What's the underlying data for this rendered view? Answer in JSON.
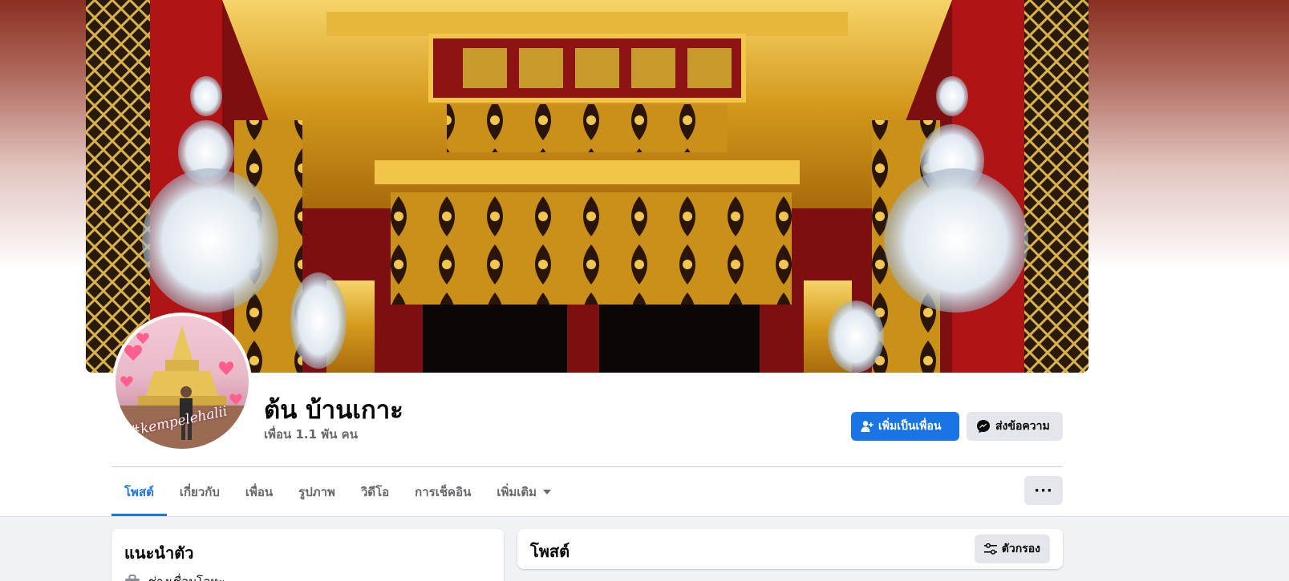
{
  "profile": {
    "name": "ต้น บ้านเกาะ",
    "friends": "เพื่อน 1.1 พัน คน",
    "avatar_tag": "#kempelehalii"
  },
  "actions": {
    "add_friend": "เพิ่มเป็นเพื่อน",
    "message": "ส่งข้อความ",
    "more": "···"
  },
  "tabs": [
    {
      "label": "โพสต์",
      "active": true
    },
    {
      "label": "เกี่ยวกับ"
    },
    {
      "label": "เพื่อน"
    },
    {
      "label": "รูปภาพ"
    },
    {
      "label": "วิดีโอ"
    },
    {
      "label": "การเช็คอิน"
    },
    {
      "label": "เพิ่มเติม"
    }
  ],
  "intro": {
    "title": "แนะนำตัว",
    "work": "ช่างเชื่อมโลหะ"
  },
  "posts": {
    "title": "โพสต์",
    "filter": "ตัวกรอง"
  },
  "colors": {
    "accent": "#1b74e4",
    "secondary_button": "#e4e6eb",
    "feed_background": "#f0f2f5"
  }
}
